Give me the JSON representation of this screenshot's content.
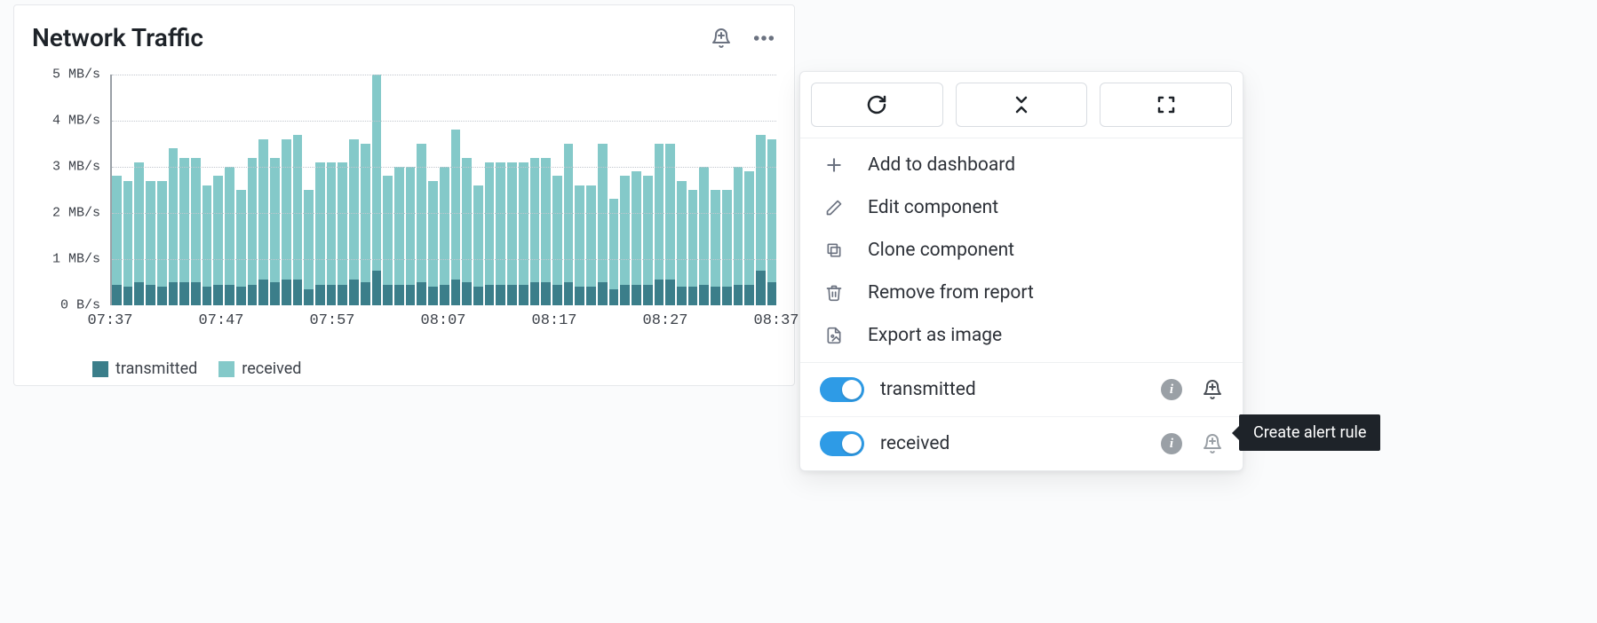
{
  "panel": {
    "title": "Network Traffic",
    "legend": {
      "transmitted": "transmitted",
      "received": "received"
    }
  },
  "chart_data": {
    "type": "bar",
    "ylabel": "",
    "xlabel": "",
    "ylim": [
      0,
      5
    ],
    "y_unit": "MB/s",
    "y_ticks": [
      {
        "v": 0,
        "label": "0 B/s"
      },
      {
        "v": 1,
        "label": "1 MB/s"
      },
      {
        "v": 2,
        "label": "2 MB/s"
      },
      {
        "v": 3,
        "label": "3 MB/s"
      },
      {
        "v": 4,
        "label": "4 MB/s"
      },
      {
        "v": 5,
        "label": "5 MB/s"
      }
    ],
    "x_ticks": [
      "07:37",
      "07:47",
      "07:57",
      "08:07",
      "08:17",
      "08:27",
      "08:37"
    ],
    "series": [
      {
        "name": "received",
        "values": [
          2.8,
          2.7,
          3.1,
          2.7,
          2.7,
          3.4,
          3.2,
          3.2,
          2.6,
          2.8,
          3.0,
          2.5,
          3.2,
          3.6,
          3.2,
          3.6,
          3.7,
          2.5,
          3.1,
          3.1,
          3.1,
          3.6,
          3.5,
          5.0,
          2.8,
          3.0,
          3.0,
          3.5,
          2.7,
          3.0,
          3.8,
          3.2,
          2.6,
          3.1,
          3.1,
          3.1,
          3.1,
          3.2,
          3.2,
          2.8,
          3.5,
          2.6,
          2.6,
          3.5,
          2.3,
          2.8,
          2.9,
          2.8,
          3.5,
          3.5,
          2.7,
          2.5,
          3.0,
          2.5,
          2.5,
          3.0,
          2.9,
          3.7,
          3.6
        ]
      },
      {
        "name": "transmitted",
        "values": [
          0.45,
          0.4,
          0.5,
          0.45,
          0.4,
          0.5,
          0.5,
          0.5,
          0.4,
          0.45,
          0.45,
          0.4,
          0.45,
          0.55,
          0.5,
          0.55,
          0.55,
          0.35,
          0.45,
          0.45,
          0.45,
          0.55,
          0.5,
          0.75,
          0.45,
          0.45,
          0.45,
          0.5,
          0.4,
          0.45,
          0.55,
          0.5,
          0.4,
          0.45,
          0.45,
          0.45,
          0.45,
          0.5,
          0.5,
          0.45,
          0.5,
          0.4,
          0.4,
          0.5,
          0.35,
          0.45,
          0.45,
          0.45,
          0.55,
          0.55,
          0.4,
          0.4,
          0.45,
          0.4,
          0.4,
          0.45,
          0.45,
          0.75,
          0.5
        ]
      }
    ]
  },
  "context_menu": {
    "toolbar": {
      "refresh": "Refresh",
      "collapse": "Collapse",
      "fullscreen": "Fullscreen"
    },
    "items": {
      "add": "Add to dashboard",
      "edit": "Edit component",
      "clone": "Clone component",
      "remove": "Remove from report",
      "export": "Export as image"
    },
    "series": [
      {
        "key": "transmitted",
        "label": "transmitted",
        "enabled": true
      },
      {
        "key": "received",
        "label": "received",
        "enabled": true
      }
    ]
  },
  "tooltip": {
    "text": "Create alert rule"
  }
}
